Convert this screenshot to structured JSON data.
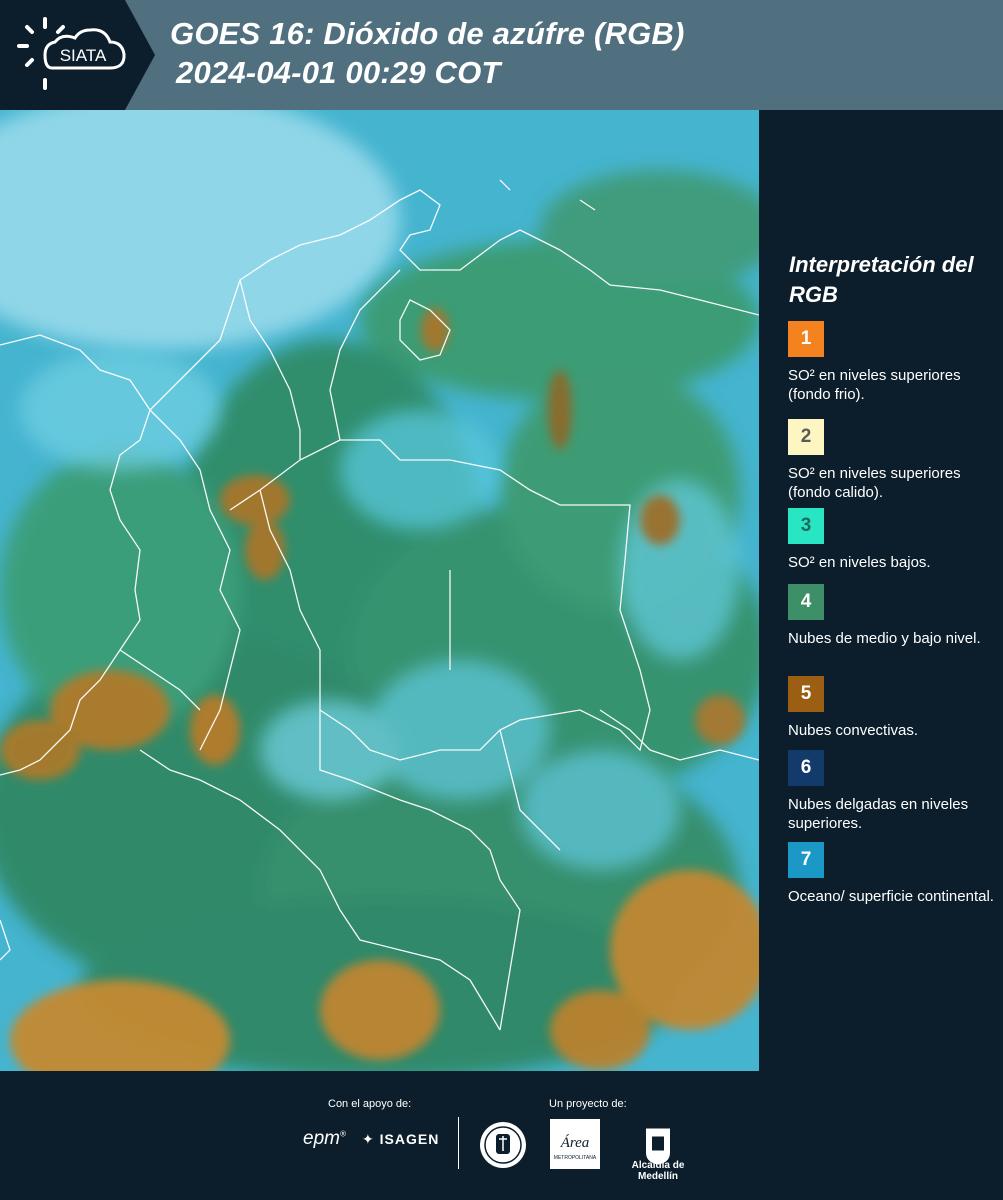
{
  "header": {
    "logo_text": "SIATA",
    "title_line1": "GOES 16: Dióxido de azúfre (RGB)",
    "title_line2": "2024-04-01 00:29 COT"
  },
  "legend": {
    "title": "Interpretación del RGB",
    "items": [
      {
        "number": "1",
        "color": "#f4821f",
        "text_color": "#ffffff",
        "label": "SO² en niveles superiores (fondo frio)."
      },
      {
        "number": "2",
        "color": "#fdf6c3",
        "text_color": "#5a5a5a",
        "label": "SO² en niveles superiores (fondo calido)."
      },
      {
        "number": "3",
        "color": "#28e6c4",
        "text_color": "#1c6b5e",
        "label": "SO² en niveles bajos."
      },
      {
        "number": "4",
        "color": "#3c8f66",
        "text_color": "#ffffff",
        "label": "Nubes de medio y bajo nivel."
      },
      {
        "number": "5",
        "color": "#9b5e12",
        "text_color": "#ffffff",
        "label": "Nubes convectivas."
      },
      {
        "number": "6",
        "color": "#123a6b",
        "text_color": "#ffffff",
        "label": "Nubes delgadas en niveles superiores."
      },
      {
        "number": "7",
        "color": "#1b98c6",
        "text_color": "#ffffff",
        "label": "Oceano/ superficie continental."
      }
    ]
  },
  "footer": {
    "support_label": "Con el apoyo de:",
    "project_label": "Un proyecto de:",
    "sponsor_1": "epm",
    "sponsor_2": "ISAGEN",
    "partner_area": "Área",
    "partner_area_sub": "METROPOLITANA",
    "partner_alcaldia": "Alcaldía de Medellín"
  }
}
